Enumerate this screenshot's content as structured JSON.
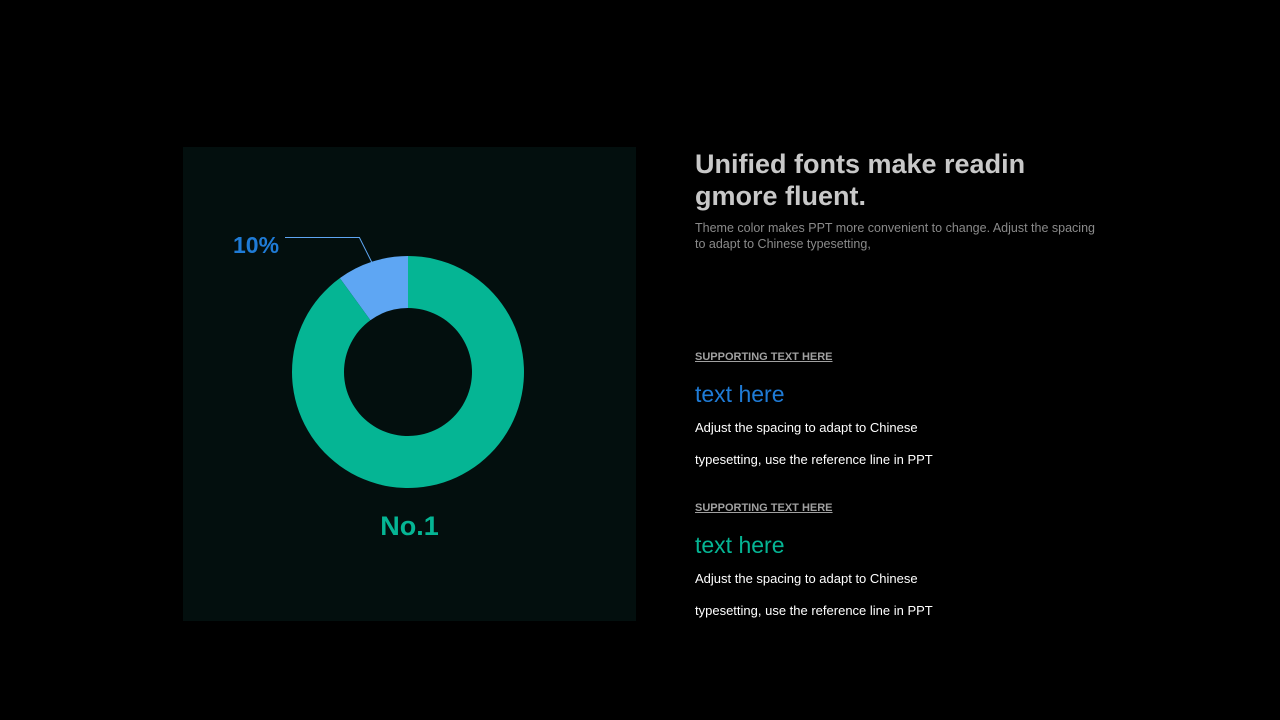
{
  "chart_data": {
    "type": "pie",
    "donut": true,
    "slices": [
      {
        "label": "10%",
        "value": 10,
        "color": "#5ea6f3"
      },
      {
        "label": "",
        "value": 90,
        "color": "#05b594"
      }
    ],
    "callout": "10%",
    "caption": "No.1"
  },
  "colors": {
    "background": "#000000",
    "panel": "#030f0e",
    "accent_teal": "#05b594",
    "accent_blue": "#1f7bd6",
    "slice_blue": "#5ea6f3"
  },
  "headline": "Unified fonts make readin gmore fluent.",
  "subline": "Theme color makes PPT more convenient to change. Adjust the spacing to adapt to Chinese typesetting,",
  "items": [
    {
      "supporting": "SUPPORTING TEXT HERE",
      "title": "text here",
      "body": "Adjust the spacing to adapt to Chinese typesetting, use the reference line in PPT"
    },
    {
      "supporting": "SUPPORTING TEXT HERE",
      "title": "text here",
      "body": "Adjust the spacing to adapt to Chinese typesetting, use the reference line in PPT"
    }
  ]
}
